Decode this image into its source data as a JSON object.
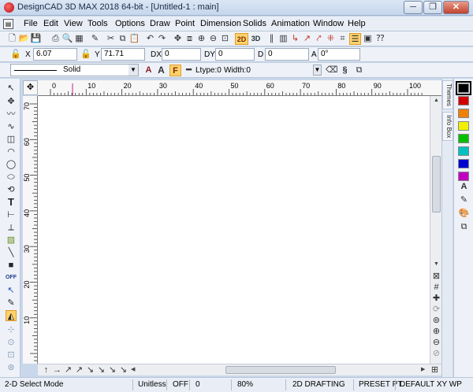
{
  "window": {
    "title": "DesignCAD 3D MAX 2018 64-bit - [Untitled-1 : main]",
    "minimize": "─",
    "restore": "❐",
    "close": "✕"
  },
  "menu": [
    "File",
    "Edit",
    "View",
    "Tools",
    "Options",
    "Draw",
    "Point",
    "Dimension",
    "Solids",
    "Animation",
    "Window",
    "Help"
  ],
  "coords": {
    "x_label": "X",
    "x_value": "6.07",
    "y_label": "Y",
    "y_value": "71.71",
    "dx_label": "DX",
    "dx_value": "0",
    "dy_label": "DY",
    "dy_value": "0",
    "d_label": "D",
    "d_value": "0",
    "a_label": "A",
    "a_value": "0°"
  },
  "linestyle": {
    "style": "Solid",
    "ltype": "Ltype:0",
    "width": "Width:0",
    "font_a1": "A",
    "font_a2": "A",
    "font_f": "F"
  },
  "toolbar": {
    "btn_2d": "2D",
    "btn_3d": "3D"
  },
  "ruler": {
    "h_ticks": [
      "0",
      "10",
      "20",
      "30",
      "40",
      "50",
      "60",
      "70",
      "80",
      "90",
      "100"
    ],
    "v_ticks": [
      "70",
      "60",
      "50",
      "40",
      "30",
      "20",
      "10"
    ]
  },
  "side_tabs": {
    "themes": "Themes",
    "info": "Info Box"
  },
  "left_tools": {
    "off_label": "OFF"
  },
  "palette_colors": [
    "#000000",
    "#d00000",
    "#f08000",
    "#f0f000",
    "#00c000",
    "#00c0c0",
    "#0000d0",
    "#c000c0"
  ],
  "status": {
    "mode": "2-D Select Mode",
    "units": "Unitless",
    "snap": "OFF",
    "snap_value": "0",
    "zoom": "80%",
    "drafting": "2D DRAFTING",
    "preset": "PRESET PT",
    "view": "DEFAULT XY WP"
  },
  "colors": {
    "chrome": "#c9d7ea",
    "toolbar": "#eef2f8",
    "canvas": "#ffffff"
  }
}
